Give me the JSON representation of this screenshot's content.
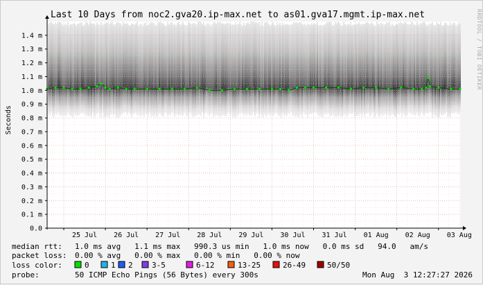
{
  "title": "Last 10 Days from noc2.gva20.ip-max.net to as01.gva17.mgmt.ip-max.net",
  "side_label": "RRDTOOL / TOBI OETIKER",
  "colors": {
    "background": "#f3f3f3",
    "plot_bg": "#ffffff",
    "grid": "#e8a0a0",
    "median": "#00e000",
    "axis": "#000000"
  },
  "chart_data": {
    "type": "line",
    "title": "Last 10 Days from noc2.gva20.ip-max.net to as01.gva17.mgmt.ip-max.net",
    "ylabel": "Seconds",
    "xlabel": "",
    "ylim": [
      0,
      1.5
    ],
    "y_unit_suffix": "m",
    "y_ticks": [
      {
        "value": 0.0,
        "label": "0.0"
      },
      {
        "value": 0.1,
        "label": "0.1 m"
      },
      {
        "value": 0.2,
        "label": "0.2 m"
      },
      {
        "value": 0.3,
        "label": "0.3 m"
      },
      {
        "value": 0.4,
        "label": "0.4 m"
      },
      {
        "value": 0.5,
        "label": "0.5 m"
      },
      {
        "value": 0.6,
        "label": "0.6 m"
      },
      {
        "value": 0.7,
        "label": "0.7 m"
      },
      {
        "value": 0.8,
        "label": "0.8 m"
      },
      {
        "value": 0.9,
        "label": "0.9 m"
      },
      {
        "value": 1.0,
        "label": "1.0 m"
      },
      {
        "value": 1.1,
        "label": "1.1 m"
      },
      {
        "value": 1.2,
        "label": "1.2 m"
      },
      {
        "value": 1.3,
        "label": "1.3 m"
      },
      {
        "value": 1.4,
        "label": "1.4 m"
      }
    ],
    "x_ticks": [
      "25 Jul",
      "26 Jul",
      "27 Jul",
      "28 Jul",
      "29 Jul",
      "30 Jul",
      "31 Jul",
      "01 Aug",
      "02 Aug",
      "03 Aug"
    ],
    "x_range_days": [
      24.6,
      34.52
    ],
    "grid": true,
    "series": [
      {
        "name": "median rtt",
        "x": [
          24.6,
          24.8,
          25.0,
          25.2,
          25.4,
          25.6,
          25.8,
          25.9,
          26.0,
          26.1,
          26.3,
          26.5,
          26.7,
          27.0,
          27.3,
          27.6,
          27.9,
          28.2,
          28.5,
          28.8,
          29.1,
          29.4,
          29.7,
          30.0,
          30.2,
          30.4,
          30.6,
          30.8,
          31.0,
          31.3,
          31.6,
          31.9,
          32.2,
          32.5,
          32.8,
          33.1,
          33.4,
          33.6,
          33.7,
          33.75,
          33.8,
          34.0,
          34.3,
          34.52
        ],
        "values": [
          1.01,
          1.02,
          1.02,
          1.01,
          1.01,
          1.02,
          1.03,
          1.05,
          1.02,
          1.01,
          1.02,
          1.01,
          1.01,
          1.01,
          1.01,
          1.01,
          1.01,
          1.02,
          1.0,
          1.0,
          1.01,
          1.01,
          1.01,
          1.01,
          1.01,
          1.0,
          1.02,
          1.02,
          1.02,
          1.02,
          1.02,
          1.01,
          1.02,
          1.02,
          1.01,
          1.02,
          1.01,
          1.01,
          1.02,
          1.09,
          1.03,
          1.02,
          1.01,
          1.01
        ]
      }
    ],
    "smoke_range": {
      "low": 0.8,
      "high": 1.5
    }
  },
  "stats": {
    "median_rtt": {
      "label": "median rtt:",
      "values": "1.0 ms avg   1.1 ms max   990.3 us min   1.0 ms now   0.0 ms sd   94.0   am/s"
    },
    "packet_loss": {
      "label": "packet loss:",
      "values": "0.00 % avg   0.00 % max   0.00 % min   0.00 % now"
    },
    "loss_color": {
      "label": "loss color:",
      "items": [
        {
          "label": "0",
          "color": "#00e000"
        },
        {
          "label": "1",
          "color": "#1fb3e4"
        },
        {
          "label": "2",
          "color": "#1f5fef"
        },
        {
          "label": "3-5",
          "color": "#7f3fdf"
        },
        {
          "label": "6-12",
          "color": "#e01fdf"
        },
        {
          "label": "13-25",
          "color": "#f06010"
        },
        {
          "label": "26-49",
          "color": "#e81010"
        },
        {
          "label": "50/50",
          "color": "#a00000"
        }
      ]
    },
    "probe": {
      "label": "probe:",
      "value": "50 ICMP Echo Pings (56 Bytes) every 300s",
      "timestamp": "Mon Aug  3 12:27:27 2026"
    }
  }
}
